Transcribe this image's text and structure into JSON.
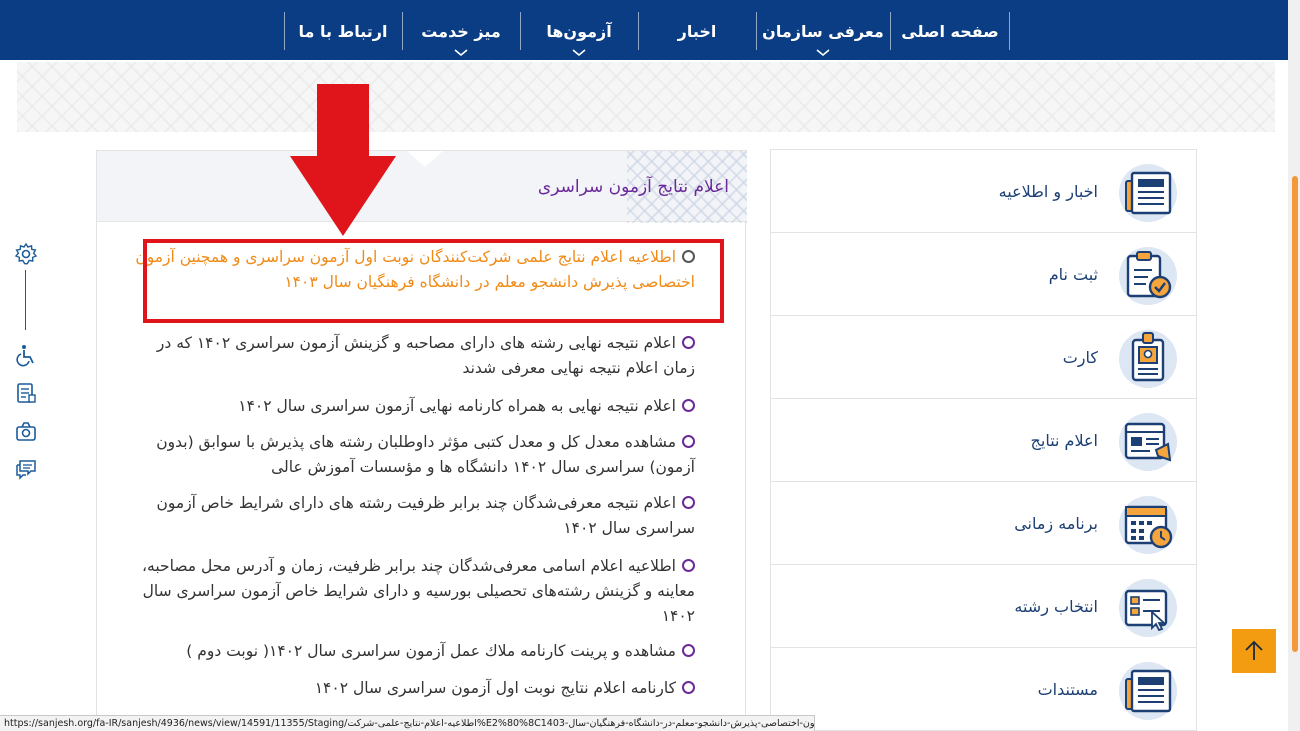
{
  "nav": {
    "items": [
      {
        "label": "صفحه اصلی",
        "has_submenu": false
      },
      {
        "label": "معرفی سازمان",
        "has_submenu": true
      },
      {
        "label": "اخبار",
        "has_submenu": false
      },
      {
        "label": "آزمون‌ها",
        "has_submenu": true
      },
      {
        "label": "میز خدمت",
        "has_submenu": true
      },
      {
        "label": "ارتباط با ما",
        "has_submenu": false
      }
    ]
  },
  "news_panel": {
    "title": "اعلام نتایج آزمون سراسری",
    "items": [
      {
        "text": "اطلاعیه اعلام نتایج علمی شرکت‌کنندگان نوبت اول آزمون سراسری و همچنین آزمون اختصاصی پذیرش دانشجو معلم در دانشگاه فرهنگیان سال ۱۴۰۳",
        "highlighted": true
      },
      {
        "text": "اعلام نتیجه نهایی رشته های دارای مصاحبه و گزینش آزمون سراسری ۱۴۰۲ که در زمان اعلام نتیجه نهایی معرفی شدند",
        "highlighted": false
      },
      {
        "text": "اعلام نتیجه نهایی به همراه کارنامه نهایی آزمون سراسری سال ۱۴۰۲",
        "highlighted": false
      },
      {
        "text": "مشاهده معدل کل و معدل کتبی مؤثر داوطلبان رشته های پذیرش با سوابق (بدون آزمون) سراسری سال ۱۴۰۲ دانشگاه ها و مؤسسات آموزش عالی",
        "highlighted": false
      },
      {
        "text": "اعلام نتیجه معرفی‌شدگان چند برابر ظرفیت رشته های دارای شرایط خاص آزمون سراسری سال ۱۴۰۲",
        "highlighted": false
      },
      {
        "text": "اطلاعیه اعلام اسامی معرفی‌شدگان چند برابر ظرفیت، زمان و آدرس محل مصاحبه، معاینه و گزینش رشته‌های تحصیلی بورسیه و دارای شرایط خاص آزمون سراسری سال ۱۴۰۲",
        "highlighted": false
      },
      {
        "text": "مشاهده و پرینت کارنامه ملاك عمل آزمون سراسری سال ۱۴۰۲( نوبت دوم )",
        "highlighted": false
      },
      {
        "text": "کارنامه اعلام نتایج نوبت اول آزمون سراسری سال ۱۴۰۲",
        "highlighted": false
      }
    ]
  },
  "quick_links": [
    {
      "label": "اخبار و اطلاعیه",
      "icon": "newspaper-icon"
    },
    {
      "label": "ثبت نام",
      "icon": "clipboard-check-icon"
    },
    {
      "label": "کارت",
      "icon": "id-card-icon"
    },
    {
      "label": "اعلام نتایج",
      "icon": "announcement-icon"
    },
    {
      "label": "برنامه زمانی",
      "icon": "calendar-clock-icon"
    },
    {
      "label": "انتخاب رشته",
      "icon": "selection-form-icon"
    },
    {
      "label": "مستندات",
      "icon": "document-icon"
    }
  ],
  "toolbar": {
    "icons": [
      "gear-icon",
      "wheelchair-icon",
      "form-icon",
      "camera-icon",
      "chat-icon"
    ]
  },
  "status_url": "https://sanjesh.org/fa-IR/sanjesh/4936/news/view/14591/11355/Staging/اطلاعیه-اعلام-نتایج-علمی-شرکت%E2%80%8C1403-کنندگان-نوبت-اول-آزمون-سراسری-و-همچنین-آزمون-اختصاصی-پذیرش-دانشجو-معلم-در-دانشگاه-فرهنگیان-سال",
  "colors": {
    "nav_bg": "#0a3d83",
    "accent_orange": "#f08a16",
    "title_purple": "#6a2a9a",
    "highlight_box": "#e0151b",
    "back_to_top": "#f39c12"
  }
}
